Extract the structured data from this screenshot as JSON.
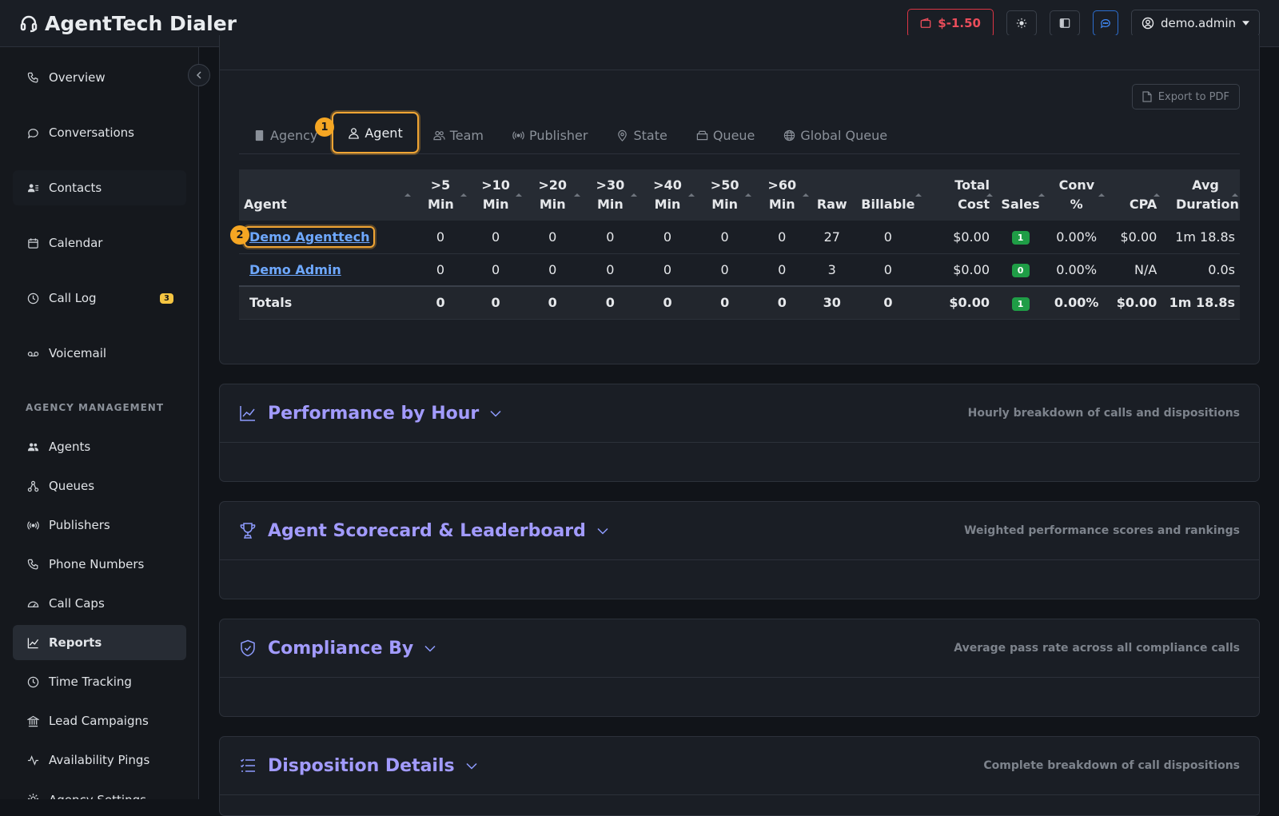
{
  "app": {
    "title": "AgentTech Dialer"
  },
  "topbar": {
    "balance": "$-1.50",
    "user": "demo.admin"
  },
  "sidebar": {
    "items": [
      {
        "label": "Overview"
      },
      {
        "label": "Conversations"
      },
      {
        "label": "Contacts"
      },
      {
        "label": "Calendar"
      },
      {
        "label": "Call Log",
        "badge": "3"
      },
      {
        "label": "Voicemail"
      }
    ],
    "section_label": "AGENCY MANAGEMENT",
    "mgmt_items": [
      {
        "label": "Agents"
      },
      {
        "label": "Queues"
      },
      {
        "label": "Publishers"
      },
      {
        "label": "Phone Numbers"
      },
      {
        "label": "Call Caps"
      },
      {
        "label": "Reports"
      },
      {
        "label": "Time Tracking"
      },
      {
        "label": "Lead Campaigns"
      },
      {
        "label": "Availability Pings"
      },
      {
        "label": "Agency Settings"
      }
    ]
  },
  "report": {
    "export_label": "Export to PDF",
    "tabs": [
      "Agency",
      "Agent",
      "Team",
      "Publisher",
      "State",
      "Queue",
      "Global Queue"
    ],
    "active_tab": "Agent",
    "markers": [
      "1",
      "2"
    ],
    "columns": [
      ">5 Min",
      ">10 Min",
      ">20 Min",
      ">30 Min",
      ">40 Min",
      ">50 Min",
      ">60 Min",
      "Raw",
      "Billable",
      "Total Cost",
      "Sales",
      "Conv %",
      "CPA",
      "Avg Duration"
    ],
    "col_first": "Agent",
    "rows": [
      {
        "agent": "Demo Agenttech",
        "m5": "0",
        "m10": "0",
        "m20": "0",
        "m30": "0",
        "m40": "0",
        "m50": "0",
        "m60": "0",
        "raw": "27",
        "billable": "0",
        "cost": "$0.00",
        "sales": "1",
        "conv": "0.00%",
        "cpa": "$0.00",
        "avg": "1m 18.8s"
      },
      {
        "agent": "Demo Admin",
        "m5": "0",
        "m10": "0",
        "m20": "0",
        "m30": "0",
        "m40": "0",
        "m50": "0",
        "m60": "0",
        "raw": "3",
        "billable": "0",
        "cost": "$0.00",
        "sales": "0",
        "conv": "0.00%",
        "cpa": "N/A",
        "avg": "0.0s"
      }
    ],
    "totals": {
      "label": "Totals",
      "m5": "0",
      "m10": "0",
      "m20": "0",
      "m30": "0",
      "m40": "0",
      "m50": "0",
      "m60": "0",
      "raw": "30",
      "billable": "0",
      "cost": "$0.00",
      "sales": "1",
      "conv": "0.00%",
      "cpa": "$0.00",
      "avg": "1m 18.8s"
    }
  },
  "sections": [
    {
      "title": "Performance by Hour",
      "subtitle": "Hourly breakdown of calls and dispositions"
    },
    {
      "title": "Agent Scorecard & Leaderboard",
      "subtitle": "Weighted performance scores and rankings"
    },
    {
      "title": "Compliance By",
      "subtitle": "Average pass rate across all compliance calls"
    },
    {
      "title": "Disposition Details",
      "subtitle": "Complete breakdown of call dispositions"
    }
  ],
  "colors": {
    "accent": "#a29bfe",
    "highlight": "#f0a534",
    "danger": "#dc3545",
    "link": "#6ea8fe",
    "success": "#1f9d46"
  }
}
